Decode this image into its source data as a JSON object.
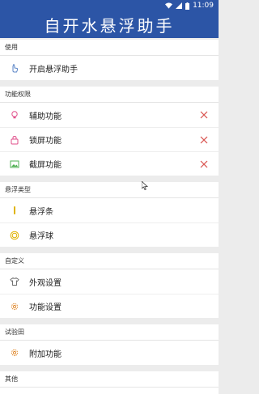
{
  "status_bar": {
    "time": "11:09"
  },
  "app_bar": {
    "title": "自开水悬浮助手"
  },
  "sections": [
    {
      "header": "使用",
      "items": [
        {
          "label": "开启悬浮助手",
          "icon": "hand-pointer-icon",
          "removable": false
        }
      ]
    },
    {
      "header": "功能权限",
      "items": [
        {
          "label": "辅助功能",
          "icon": "lightbulb-icon",
          "removable": true
        },
        {
          "label": "锁屏功能",
          "icon": "lock-icon",
          "removable": true
        },
        {
          "label": "截屏功能",
          "icon": "image-icon",
          "removable": true
        }
      ]
    },
    {
      "header": "悬浮类型",
      "items": [
        {
          "label": "悬浮条",
          "icon": "bar-icon",
          "removable": false
        },
        {
          "label": "悬浮球",
          "icon": "ball-icon",
          "removable": false
        }
      ]
    },
    {
      "header": "自定义",
      "items": [
        {
          "label": "外观设置",
          "icon": "shirt-icon",
          "removable": false
        },
        {
          "label": "功能设置",
          "icon": "gear-icon",
          "removable": false
        }
      ]
    },
    {
      "header": "试验田",
      "items": [
        {
          "label": "附加功能",
          "icon": "gear-icon",
          "removable": false
        }
      ]
    },
    {
      "header": "其他",
      "items": []
    }
  ],
  "colors": {
    "primary": "#2c55a6",
    "close": "#d9534f",
    "accent_gold": "#e0b300"
  }
}
